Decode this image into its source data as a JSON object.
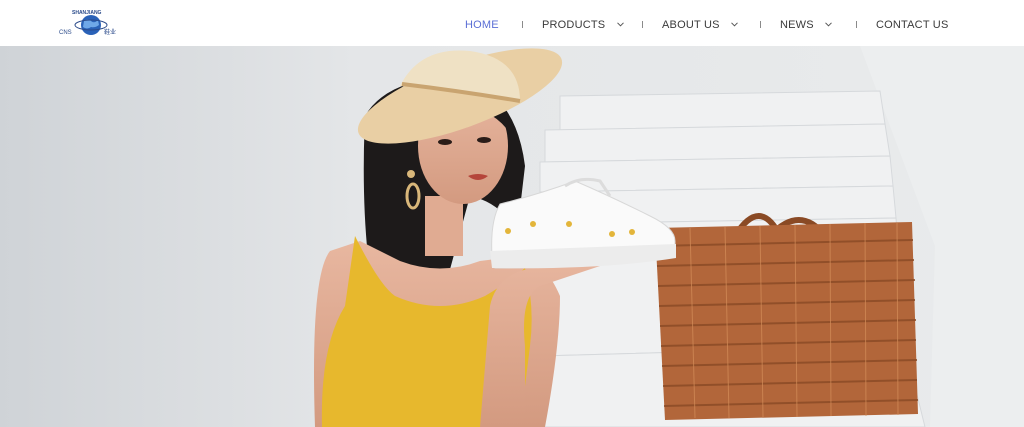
{
  "logo": {
    "text_top": "SHANJIANG",
    "text_left": "CNS",
    "text_right": "鞋业"
  },
  "nav": [
    {
      "label": "HOME",
      "active": true,
      "dropdown": false
    },
    {
      "label": "PRODUCTS",
      "active": false,
      "dropdown": true
    },
    {
      "label": "ABOUT US",
      "active": false,
      "dropdown": true
    },
    {
      "label": "NEWS",
      "active": false,
      "dropdown": true
    },
    {
      "label": "CONTACT US",
      "active": false,
      "dropdown": false
    }
  ],
  "icons": {
    "dropdown": "chevron-down-icon",
    "logo": "globe-logo"
  },
  "colors": {
    "active_nav": "#5b6fd6",
    "nav_text": "#3a3a3a",
    "header_bg": "#ffffff",
    "hero_bg": "#dfe2e5"
  }
}
